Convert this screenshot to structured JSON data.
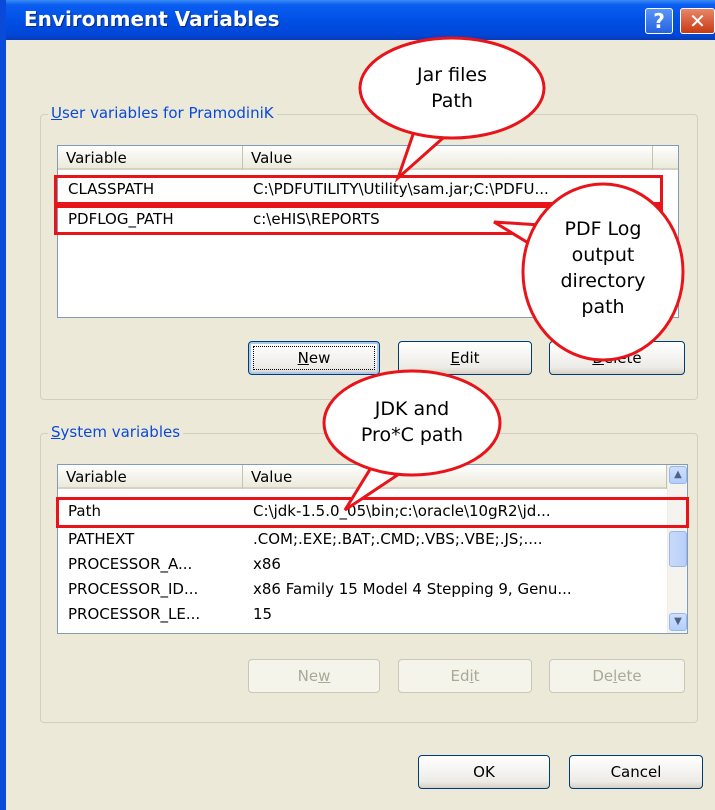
{
  "window": {
    "title": "Environment Variables",
    "help_glyph": "?",
    "close_glyph": "✕"
  },
  "user_group": {
    "label_mnemonic": "U",
    "label_rest": "ser variables for PramodiniK",
    "columns": [
      "Variable",
      "Value"
    ],
    "rows": [
      {
        "variable": "CLASSPATH",
        "value": "C:\\PDFUTILITY\\Utility\\sam.jar;C:\\PDFU..."
      },
      {
        "variable": "PDFLOG_PATH",
        "value": "c:\\eHIS\\REPORTS"
      }
    ],
    "buttons": {
      "new_mnemonic": "N",
      "new_rest": "ew",
      "edit_mnemonic": "E",
      "edit_rest": "dit",
      "delete_mnemonic": "D",
      "delete_rest": "elete"
    }
  },
  "system_group": {
    "label_mnemonic": "S",
    "label_rest": "ystem variables",
    "columns": [
      "Variable",
      "Value"
    ],
    "rows": [
      {
        "variable": "Path",
        "value": "C:\\jdk-1.5.0_05\\bin;c:\\oracle\\10gR2\\jd..."
      },
      {
        "variable": "PATHEXT",
        "value": ".COM;.EXE;.BAT;.CMD;.VBS;.VBE;.JS;...."
      },
      {
        "variable": "PROCESSOR_A...",
        "value": "x86"
      },
      {
        "variable": "PROCESSOR_ID...",
        "value": "x86 Family 15 Model 4 Stepping 9, Genu..."
      },
      {
        "variable": "PROCESSOR_LE...",
        "value": "15"
      }
    ],
    "buttons": {
      "new_pre": "Ne",
      "new_mnemonic": "w",
      "edit_pre": "Ed",
      "edit_mnemonic": "i",
      "edit_post": "t",
      "delete_pre": "De",
      "delete_mnemonic": "l",
      "delete_post": "ete"
    }
  },
  "dialog_buttons": {
    "ok": "OK",
    "cancel": "Cancel"
  },
  "callouts": {
    "jar": {
      "line1": "Jar files",
      "line2": "Path"
    },
    "pdflog": {
      "line1": "PDF Log",
      "line2": "output",
      "line3": "directory",
      "line4": "path"
    },
    "jdk": {
      "line1": "JDK and",
      "line2": "Pro*C path"
    }
  },
  "colors": {
    "highlight": "#e8141a",
    "title_bar": "#0050e6",
    "dialog_bg": "#ece9d8"
  }
}
